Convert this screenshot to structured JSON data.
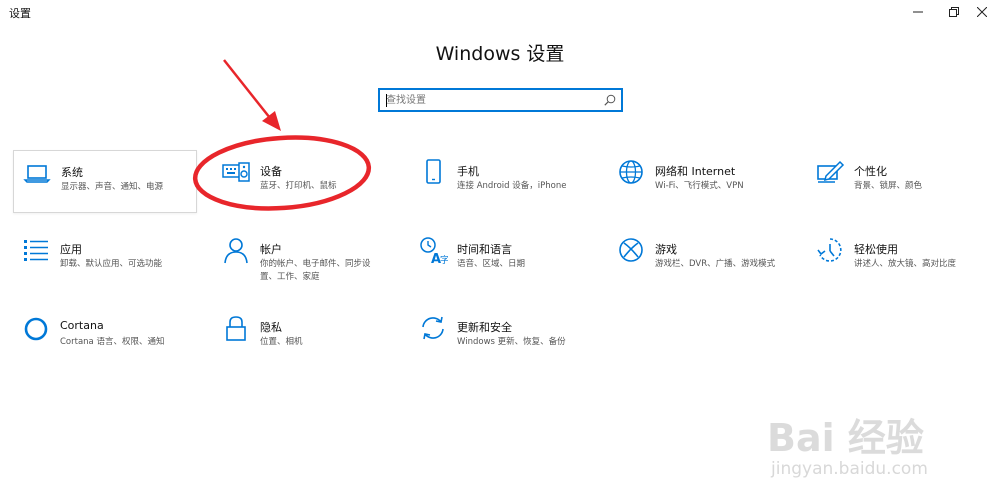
{
  "window": {
    "title": "设置",
    "controls": [
      "minimize",
      "restore",
      "close"
    ]
  },
  "header": {
    "title": "Windows 设置"
  },
  "search": {
    "placeholder": "查找设置",
    "icon": "search-icon"
  },
  "colors": {
    "accent": "#0078d7",
    "annotation": "#e8262b"
  },
  "tiles": [
    {
      "id": "system",
      "title": "系统",
      "desc": [
        "显示器、声音、通知、电源"
      ],
      "icon": "laptop-icon",
      "hovered": true
    },
    {
      "id": "devices",
      "title": "设备",
      "desc": [
        "蓝牙、打印机、鼠标"
      ],
      "icon": "keyboard-speaker-icon"
    },
    {
      "id": "phone",
      "title": "手机",
      "desc": [
        "连接 Android 设备，iPhone"
      ],
      "icon": "phone-icon"
    },
    {
      "id": "network",
      "title": "网络和 Internet",
      "desc": [
        "Wi-Fi、飞行模式、VPN"
      ],
      "icon": "globe-icon"
    },
    {
      "id": "personalization",
      "title": "个性化",
      "desc": [
        "背景、锁屏、颜色"
      ],
      "icon": "paint-pen-icon"
    },
    {
      "id": "apps",
      "title": "应用",
      "desc": [
        "卸载、默认应用、可选功能"
      ],
      "icon": "apps-list-icon"
    },
    {
      "id": "accounts",
      "title": "帐户",
      "desc": [
        "你的帐户、电子邮件、同步设",
        "置、工作、家庭"
      ],
      "icon": "person-icon"
    },
    {
      "id": "time-language",
      "title": "时间和语言",
      "desc": [
        "语音、区域、日期"
      ],
      "icon": "time-language-icon"
    },
    {
      "id": "gaming",
      "title": "游戏",
      "desc": [
        "游戏栏、DVR、广播、游戏模式"
      ],
      "icon": "xbox-icon"
    },
    {
      "id": "ease-of-access",
      "title": "轻松使用",
      "desc": [
        "讲述人、放大镜、高对比度"
      ],
      "icon": "ease-of-access-icon"
    },
    {
      "id": "cortana",
      "title": "Cortana",
      "desc": [
        "Cortana 语言、权限、通知"
      ],
      "icon": "cortana-icon"
    },
    {
      "id": "privacy",
      "title": "隐私",
      "desc": [
        "位置、相机"
      ],
      "icon": "lock-icon"
    },
    {
      "id": "update-security",
      "title": "更新和安全",
      "desc": [
        "Windows 更新、恢复、备份"
      ],
      "icon": "sync-icon"
    }
  ],
  "watermark": {
    "brand": "Bai 经验",
    "url": "jingyan.baidu.com"
  }
}
